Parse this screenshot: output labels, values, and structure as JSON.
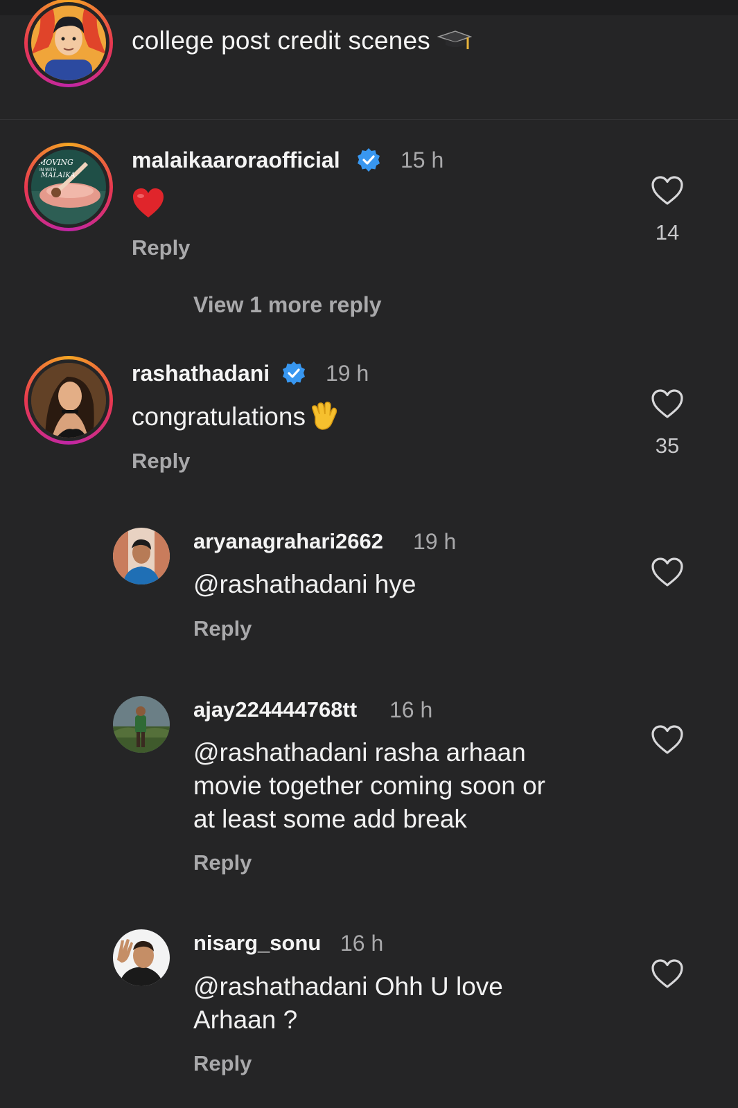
{
  "post": {
    "caption": "college post credit scenes"
  },
  "comments": [
    {
      "username": "malaikaaroraofficial",
      "verified": true,
      "time": "15 h",
      "text": "",
      "emoji": "red-heart",
      "reply_label": "Reply",
      "likes": "14",
      "view_more": "View 1 more reply",
      "avatar_text": [
        "MOVING",
        "IN WITH",
        "MALAIKA"
      ]
    },
    {
      "username": "rashathadani",
      "verified": true,
      "time": "19 h",
      "text": "congratulations",
      "emoji": "waving-hand",
      "reply_label": "Reply",
      "likes": "35"
    }
  ],
  "replies": [
    {
      "username": "aryanagrahari2662",
      "time": "19 h",
      "text_lines": [
        "@rashathadani hye"
      ],
      "reply_label": "Reply"
    },
    {
      "username": "ajay224444768tt",
      "time": "16 h",
      "text_lines": [
        "@rashathadani rasha arhaan",
        "movie together coming soon or",
        "at least some add break"
      ],
      "reply_label": "Reply"
    },
    {
      "username": "nisarg_sonu",
      "time": "16 h",
      "text_lines": [
        "@rashathadani Ohh U love",
        "Arhaan ?"
      ],
      "reply_label": "Reply"
    }
  ],
  "colors": {
    "background": "#252526",
    "muted_text": "#a9a9ab",
    "verified_badge": "#3897f0",
    "heart_emoji": "#e0252b"
  }
}
